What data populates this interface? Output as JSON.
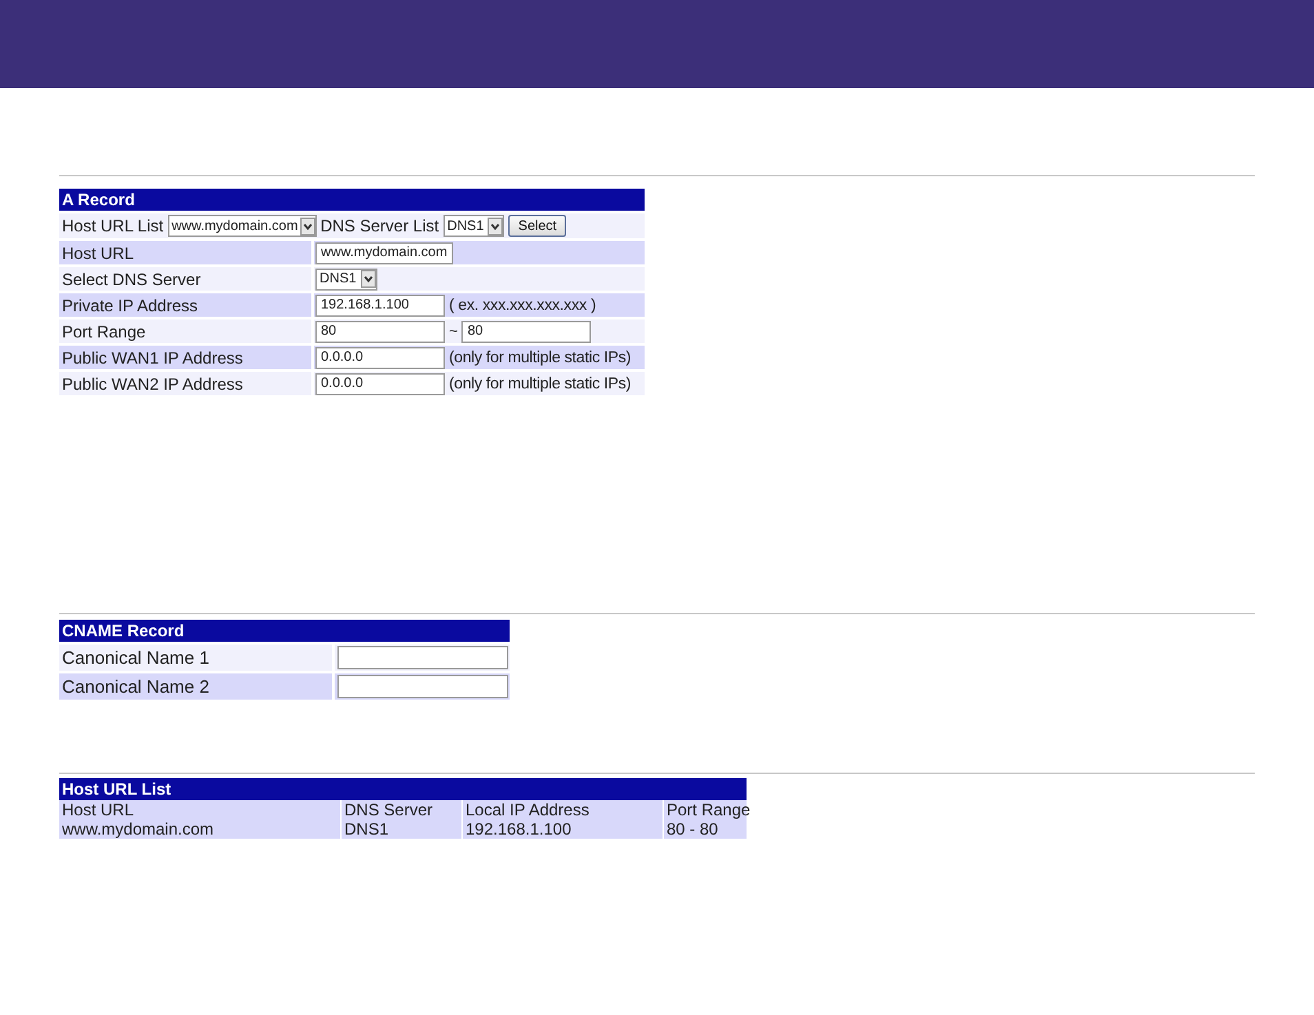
{
  "a_record": {
    "title": "A Record",
    "picker": {
      "host_label": "Host URL List",
      "host_value": "www.mydomain.com",
      "dns_label": "DNS Server List",
      "dns_value": "DNS1",
      "button": "Select"
    },
    "rows": [
      {
        "label": "Host URL",
        "kind": "input",
        "value": "www.mydomain.com"
      },
      {
        "label": "Select DNS Server",
        "kind": "select",
        "value": "DNS1"
      },
      {
        "label": "Private IP Address",
        "kind": "input",
        "value": "192.168.1.100",
        "hint": "( ex. xxx.xxx.xxx.xxx )"
      },
      {
        "label": "Port Range",
        "kind": "range",
        "value": "80",
        "separator": "~",
        "value2": "80"
      },
      {
        "label": "Public WAN1 IP Address",
        "kind": "input",
        "value": "0.0.0.0",
        "hint": "(only for multiple static IPs)"
      },
      {
        "label": "Public WAN2 IP Address",
        "kind": "input",
        "value": "0.0.0.0",
        "hint": "(only for multiple static IPs)"
      }
    ]
  },
  "cname_record": {
    "title": "CNAME Record",
    "rows": [
      {
        "label": "Canonical Name 1"
      },
      {
        "label": "Canonical Name 2"
      }
    ]
  },
  "host_url_list": {
    "title": "Host URL List",
    "columns": [
      "Host URL",
      "DNS Server",
      "Local IP Address",
      "Port Range"
    ],
    "rows": [
      [
        "www.mydomain.com",
        "DNS1",
        "192.168.1.100",
        "80 - 80"
      ]
    ]
  }
}
